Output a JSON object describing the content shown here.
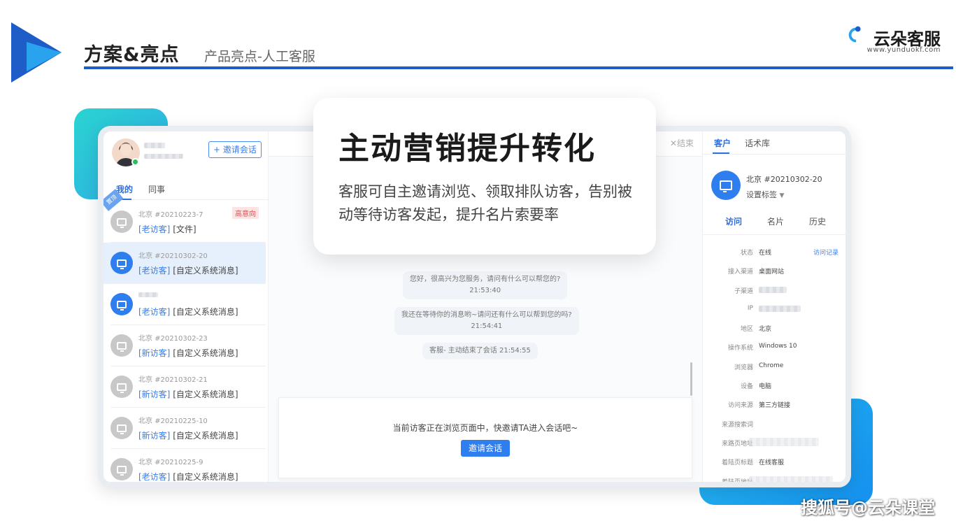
{
  "header": {
    "title": "方案&亮点",
    "subtitle": "产品亮点-人工客服",
    "accent_color": "#1e5cc8",
    "brand": {
      "name": "云朵客服",
      "url": "www.yunduokf.com"
    }
  },
  "card": {
    "title": "主动营销提升转化",
    "body": "客服可自主邀请浏览、领取排队访客，告别被动等待访客发起，提升名片索要率"
  },
  "left_panel": {
    "invite_button": "+ 邀请会话",
    "tabs": [
      "我的",
      "同事"
    ],
    "conversations": [
      {
        "name": "北京 #20210223-7",
        "tag": "[老访客]",
        "text": " [文件]",
        "badge": "高意向",
        "avatar": "gray"
      },
      {
        "name": "北京 #20210302-20",
        "tag": "[老访客]",
        "text": " [自定义系统消息]",
        "badge": "",
        "avatar": "blue"
      },
      {
        "name": "",
        "tag": "[老访客]",
        "text": " [自定义系统消息]",
        "badge": "",
        "avatar": "blue"
      },
      {
        "name": "北京 #20210302-23",
        "tag": "[新访客]",
        "text": " [自定义系统消息]",
        "badge": "",
        "avatar": "gray"
      },
      {
        "name": "北京 #20210302-21",
        "tag": "[新访客]",
        "text": " [自定义系统消息]",
        "badge": "",
        "avatar": "gray"
      },
      {
        "name": "北京 #20210225-10",
        "tag": "[新访客]",
        "text": " [自定义系统消息]",
        "badge": "",
        "avatar": "gray"
      },
      {
        "name": "北京 #20210225-9",
        "tag": "[老访客]",
        "text": " [自定义系统消息]",
        "badge": "",
        "avatar": "gray"
      }
    ]
  },
  "chat": {
    "end_label": "✕结束",
    "messages": [
      {
        "text": "您好，很高兴为您服务，请问有什么可以帮您的?",
        "time": "21:53:40"
      },
      {
        "text": "我还在等待你的消息哟~请问还有什么可以帮到您的吗?",
        "time": "21:54:41"
      },
      {
        "text": "客服-     主动结束了会话 21:54:55",
        "time": ""
      }
    ],
    "invite_prompt": "当前访客正在浏览页面中，快邀请TA进入会话吧~",
    "invite_button": "邀请会话"
  },
  "right_panel": {
    "tabs": [
      "客户",
      "话术库"
    ],
    "visitor_name": "北京 #20210302-20",
    "set_tag": "设置标签",
    "sub_tabs": [
      "访问",
      "名片",
      "历史"
    ],
    "visit_log_link": "访问记录",
    "info": [
      {
        "k": "状态",
        "v": "在线"
      },
      {
        "k": "接入渠道",
        "v": "桌面网站"
      },
      {
        "k": "子渠道",
        "v": ""
      },
      {
        "k": "IP",
        "v": ""
      },
      {
        "k": "地区",
        "v": "北京"
      },
      {
        "k": "操作系统",
        "v": "Windows 10"
      },
      {
        "k": "浏览器",
        "v": "Chrome"
      },
      {
        "k": "设备",
        "v": "电脑"
      },
      {
        "k": "访问来源",
        "v": "第三方链接"
      },
      {
        "k": "来源搜索词",
        "v": ""
      },
      {
        "k": "来路页地址",
        "v": ""
      },
      {
        "k": "着陆页标题",
        "v": "在线客服"
      },
      {
        "k": "着陆页地址",
        "v": ""
      }
    ]
  },
  "watermark": "搜狐号@云朵课堂"
}
